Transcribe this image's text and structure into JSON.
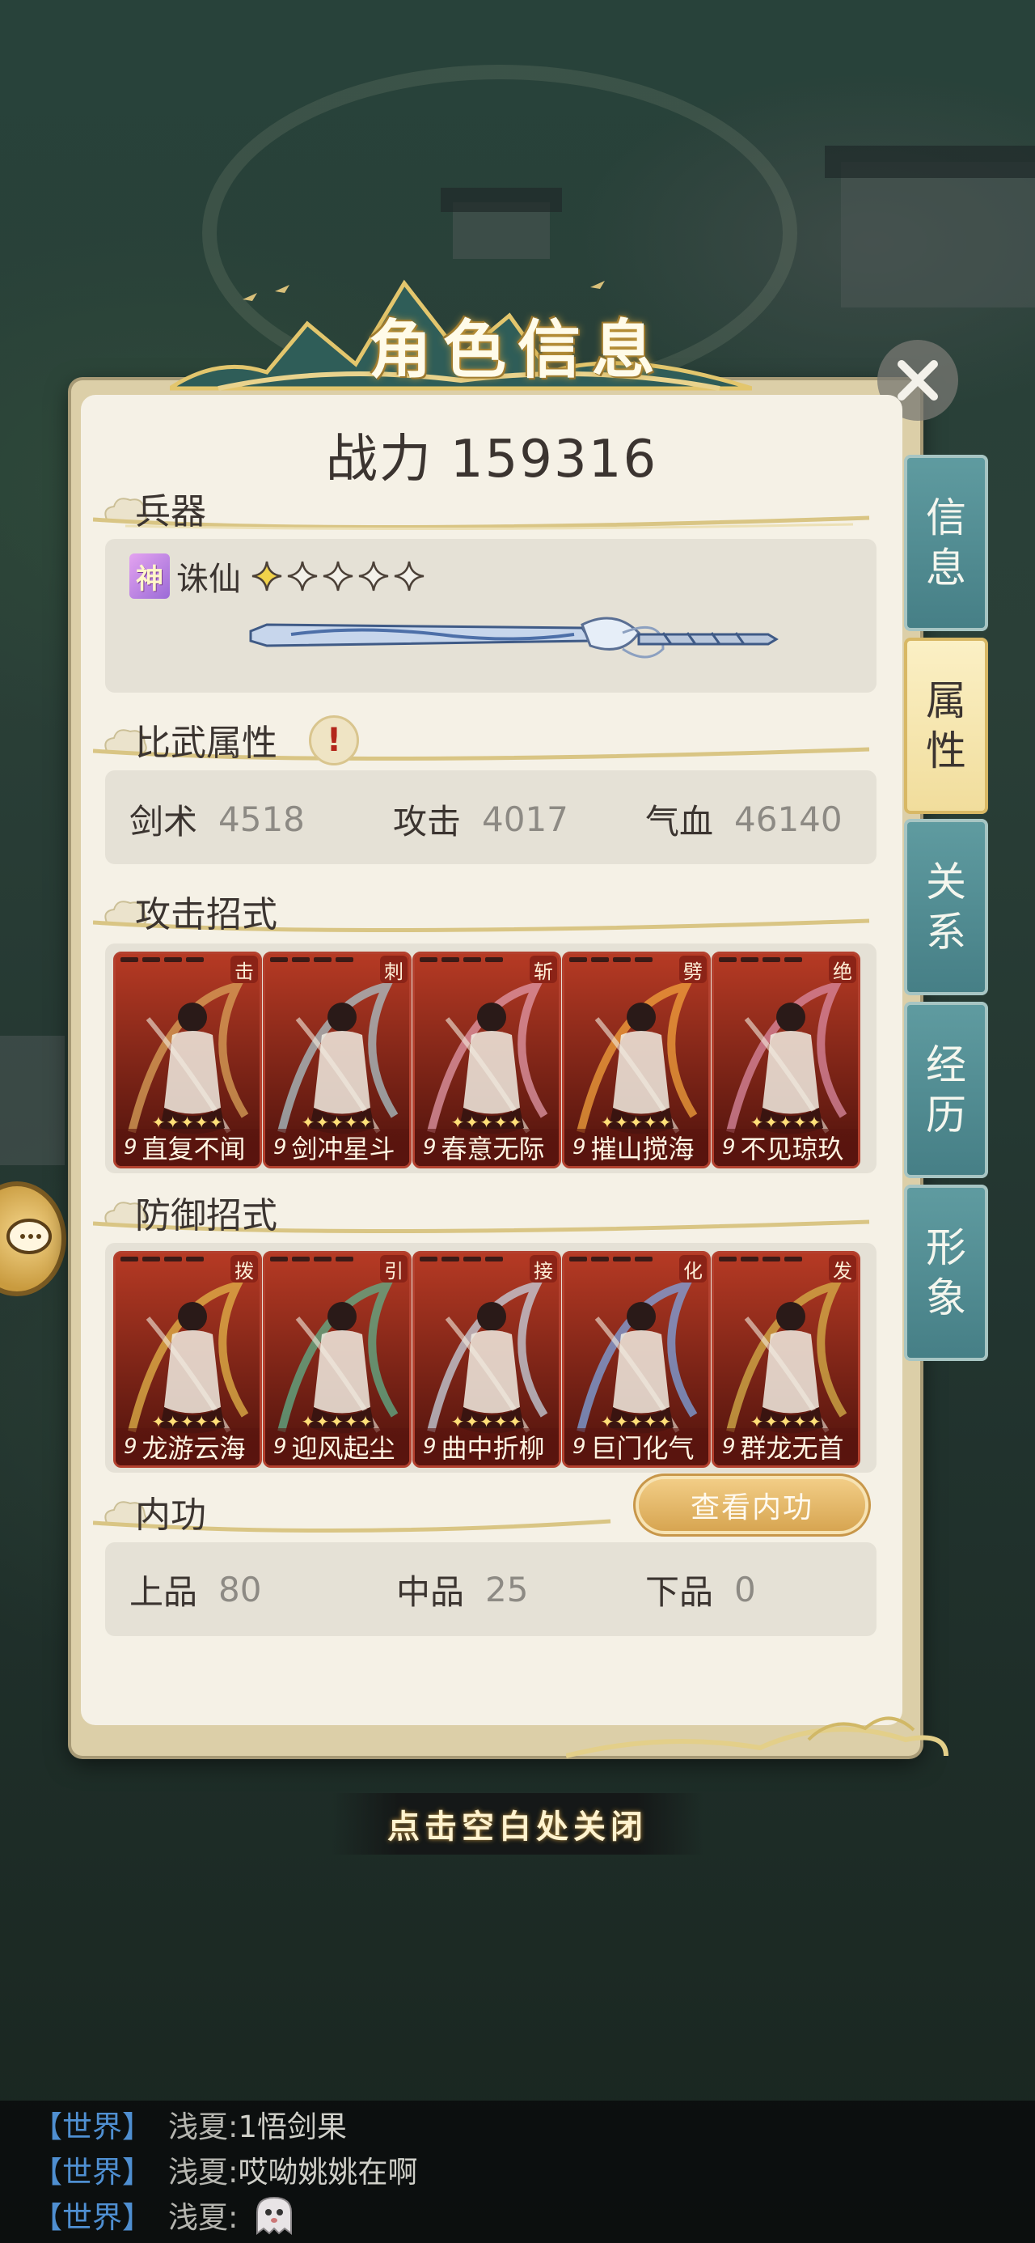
{
  "title": "角色信息",
  "power": {
    "label": "战力",
    "value": "159316"
  },
  "weapon": {
    "section_label": "兵器",
    "tier_badge": "神",
    "name": "诛仙",
    "stars_total": 5,
    "stars_filled": 1
  },
  "pvp": {
    "section_label": "比武属性",
    "alert": "!",
    "stats": [
      {
        "label": "剑术",
        "value": "4518"
      },
      {
        "label": "攻击",
        "value": "4017"
      },
      {
        "label": "气血",
        "value": "46140"
      }
    ]
  },
  "attack_moves": {
    "section_label": "攻击招式",
    "cards": [
      {
        "tag": "击",
        "level": "9",
        "name": "直复不闻",
        "accent": "#d9a35a"
      },
      {
        "tag": "刺",
        "level": "9",
        "name": "剑冲星斗",
        "accent": "#a9c3c8"
      },
      {
        "tag": "斩",
        "level": "9",
        "name": "春意无际",
        "accent": "#e29aa8"
      },
      {
        "tag": "劈",
        "level": "9",
        "name": "摧山搅海",
        "accent": "#f2a23c"
      },
      {
        "tag": "绝",
        "level": "9",
        "name": "不见琼玖",
        "accent": "#d98aa0"
      }
    ]
  },
  "defense_moves": {
    "section_label": "防御招式",
    "cards": [
      {
        "tag": "拨",
        "level": "9",
        "name": "龙游云海",
        "accent": "#e3b64a"
      },
      {
        "tag": "引",
        "level": "9",
        "name": "迎风起尘",
        "accent": "#5fb08a"
      },
      {
        "tag": "接",
        "level": "9",
        "name": "曲中折柳",
        "accent": "#c7d3df"
      },
      {
        "tag": "化",
        "level": "9",
        "name": "巨门化气",
        "accent": "#7ea4e0"
      },
      {
        "tag": "发",
        "level": "9",
        "name": "群龙无首",
        "accent": "#d5b24a"
      }
    ]
  },
  "inner_power": {
    "section_label": "内功",
    "view_button": "查看内功",
    "stats": [
      {
        "label": "上品",
        "value": "80"
      },
      {
        "label": "中品",
        "value": "25"
      },
      {
        "label": "下品",
        "value": "0"
      }
    ]
  },
  "tabs": [
    {
      "label_1": "信",
      "label_2": "息",
      "active": false
    },
    {
      "label_1": "属",
      "label_2": "性",
      "active": true
    },
    {
      "label_1": "关",
      "label_2": "系",
      "active": false
    },
    {
      "label_1": "经",
      "label_2": "历",
      "active": false
    },
    {
      "label_1": "形",
      "label_2": "象",
      "active": false
    }
  ],
  "close_hint": "点击空白处关闭",
  "chat": [
    {
      "channel": "【世界】",
      "name": "浅夏:",
      "text": "1悟剑果"
    },
    {
      "channel": "【世界】",
      "name": "浅夏:",
      "text": "哎呦姚姚在啊"
    },
    {
      "channel": "【世界】",
      "name": "浅夏:",
      "text": ""
    }
  ],
  "colors": {
    "tab_teal": "#4f8a90",
    "tab_active": "#f3e1a2",
    "card_red": "#8b2317",
    "chat_channel": "#4f8fd1",
    "gold": "#d7a551"
  }
}
